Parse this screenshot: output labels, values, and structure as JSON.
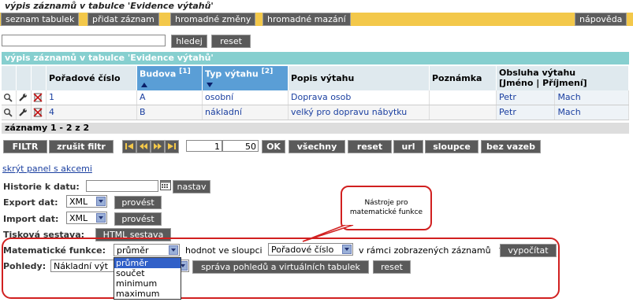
{
  "page_title": "výpis záznamů v tabulce 'Evidence výtahů'",
  "menu": {
    "items": [
      "seznam tabulek",
      "přidat záznam",
      "hromadné změny",
      "hromadné mazání"
    ],
    "help": "nápověda"
  },
  "search": {
    "value": "",
    "search_label": "hledej",
    "reset_label": "reset"
  },
  "table": {
    "caption": "výpis záznamů v tabulce 'Evidence výtahů'",
    "headers": {
      "order": "Pořadové číslo",
      "building": "Budova",
      "building_sort": "[1]",
      "type": "Typ výtahu",
      "type_sort": "[2]",
      "desc": "Popis výtahu",
      "note": "Poznámka",
      "service": "Obsluha výtahu",
      "service_sub": "[Jméno | Příjmení]"
    },
    "rows": [
      {
        "order": "1",
        "building": "A",
        "type": "osobní",
        "desc": "Doprava osob",
        "note": "",
        "first": "Petr",
        "last": "Mach"
      },
      {
        "order": "4",
        "building": "B",
        "type": "nákladní",
        "desc": "velký pro dopravu nábytku",
        "note": "",
        "first": "Petr",
        "last": "Mach"
      }
    ],
    "summary": "záznamy 1 - 2 z 2"
  },
  "pager": {
    "filter": "FILTR",
    "cancel_filter": "zrušit filtr",
    "from": "1",
    "count": "50",
    "ok": "OK",
    "all": "všechny",
    "reset": "reset",
    "url": "url",
    "columns": "sloupce",
    "no_links": "bez vazeb"
  },
  "actions": {
    "hide_panel": "skrýt panel s akcemi",
    "history_label": "Historie k datu:",
    "history_value": "",
    "history_btn": "nastav",
    "export_label": "Export dat:",
    "export_format": "XML",
    "export_btn": "provést",
    "import_label": "Import dat:",
    "import_format": "XML",
    "import_btn": "provést",
    "print_label": "Tisková sestava:",
    "print_btn": "HTML sestava",
    "math_label": "Matematické funkce:",
    "math_selected": "průměr",
    "math_mid": "hodnot ve sloupci",
    "math_column": "Pořadové číslo",
    "math_suffix": "v rámci zobrazených záznamů",
    "math_btn": "vypočítat",
    "math_options": [
      "průměr",
      "součet",
      "minimum",
      "maximum"
    ],
    "views_label": "Pohledy:",
    "views_selected": "Nákladní výt",
    "views_manage_btn": "správa pohledů a virtuálních tabulek",
    "views_reset_btn": "reset"
  },
  "callout": {
    "text": "Nástroje pro matematické funkce"
  },
  "icons": [
    "magnifier-icon",
    "wrench-icon",
    "delete-icon",
    "first-page-icon",
    "prev-page-icon",
    "next-page-icon",
    "last-page-icon",
    "calendar-icon",
    "sort-asc-icon",
    "sort-desc-icon"
  ]
}
